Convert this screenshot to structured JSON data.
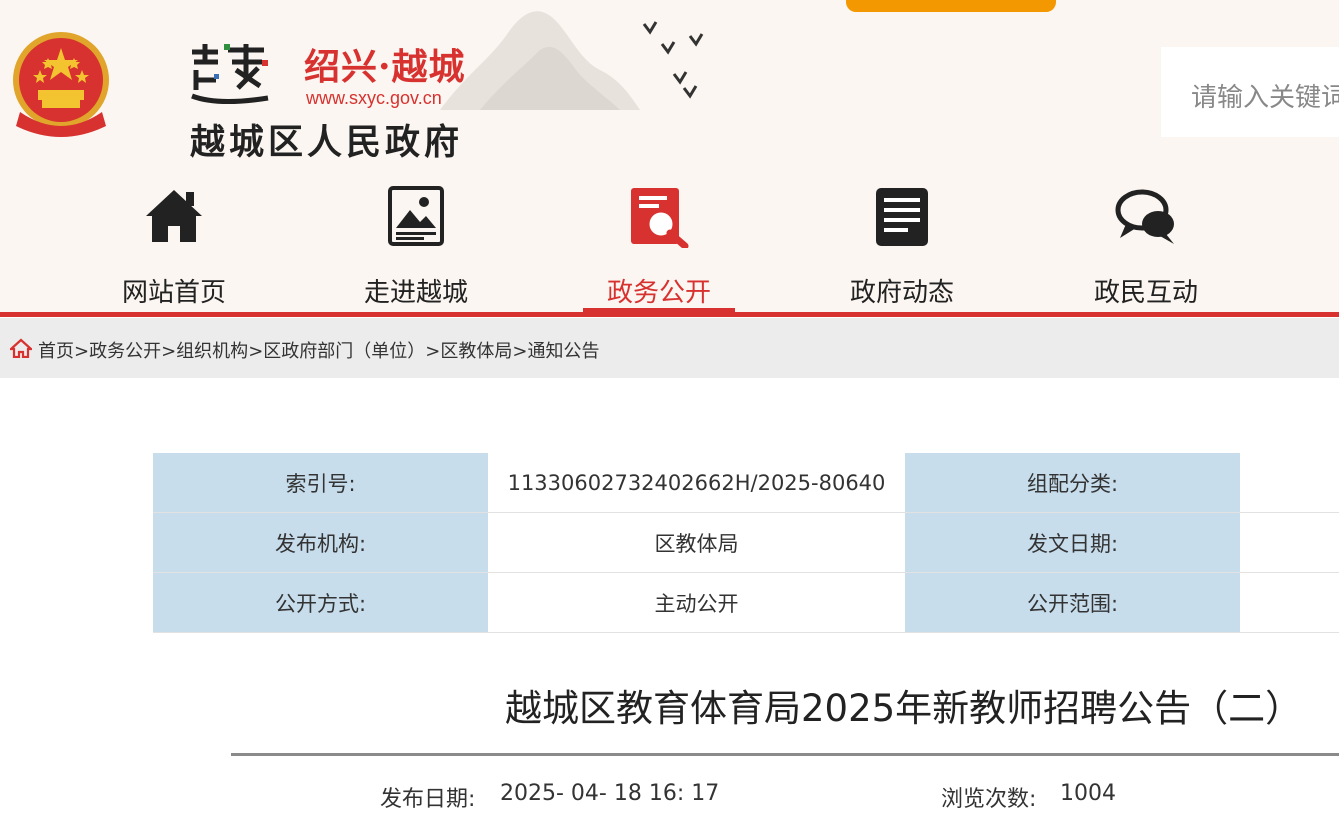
{
  "header": {
    "brand": "绍兴·越城",
    "url": "www.sxyc.gov.cn",
    "gov_name": "越城区人民政府",
    "search_placeholder": "请输入关键词"
  },
  "nav": {
    "items": [
      {
        "label": "网站首页",
        "icon": "home-icon"
      },
      {
        "label": "走进越城",
        "icon": "picture-icon"
      },
      {
        "label": "政务公开",
        "icon": "magnifier-doc-icon",
        "active": true
      },
      {
        "label": "政府动态",
        "icon": "document-icon"
      },
      {
        "label": "政民互动",
        "icon": "chat-bubbles-icon"
      }
    ]
  },
  "breadcrumb": [
    "首页",
    "政务公开",
    "组织机构",
    "区政府部门（单位）",
    "区教体局",
    "通知公告"
  ],
  "info_table": {
    "index_label": "索引号:",
    "index_value": "11330602732402662H/2025-80640",
    "category_label": "组配分类:",
    "publisher_label": "发布机构:",
    "publisher_value": "区教体局",
    "doc_date_label": "发文日期:",
    "method_label": "公开方式:",
    "method_value": "主动公开",
    "scope_label": "公开范围:"
  },
  "article": {
    "title": "越城区教育体育局2025年新教师招聘公告（二）",
    "publish_date_label": "发布日期:",
    "publish_date": "2025- 04- 18 16: 17",
    "views_label": "浏览次数:",
    "views": "1004"
  },
  "colors": {
    "accent_red": "#d7322f",
    "header_bg": "#fbf6f1",
    "table_key_bg": "#c7ddec",
    "banner_orange": "#f39800"
  }
}
